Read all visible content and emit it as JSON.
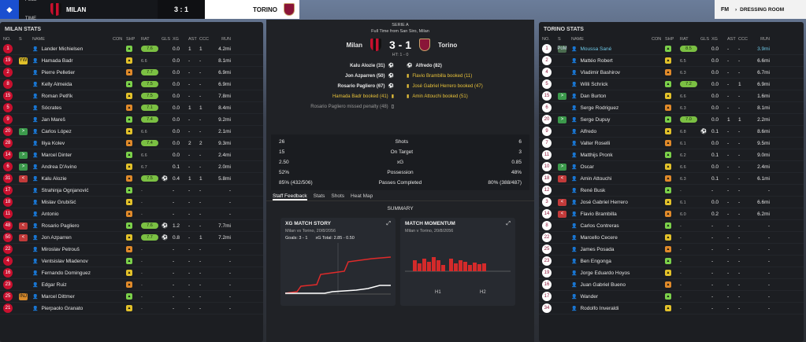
{
  "topbar": {
    "status": "FULL TIME",
    "home_team": "MILAN",
    "score": "3 : 1",
    "away_team": "TORINO",
    "fm_logo": "FM",
    "dressing_room": "DRESSING ROOM"
  },
  "milan": {
    "title": "MILAN STATS",
    "headers": {
      "no": "NO.",
      "s": "S",
      "name": "NAME",
      "con": "CON",
      "shp": "SHP",
      "rat": "RAT",
      "gls": "GLS",
      "xg": "XG",
      "ast": "AST",
      "ccc": "CCC",
      "run": "RUN"
    },
    "players": [
      {
        "no": "1",
        "s": "",
        "name": "Lander Michielsen",
        "rat": "7.6",
        "pill": true,
        "gls": "",
        "xg": "0.0",
        "ast": "1",
        "ccc": "1",
        "run": "4.2mi"
      },
      {
        "no": "19",
        "s": "sub",
        "name": "Hamada Badr",
        "rat": "6.6",
        "pill": false,
        "gls": "",
        "xg": "0.0",
        "ast": "-",
        "ccc": "-",
        "run": "8.1mi"
      },
      {
        "no": "2",
        "s": "",
        "name": "Pierre Pelletier",
        "rat": "7.7",
        "pill": true,
        "gls": "",
        "xg": "0.0",
        "ast": "-",
        "ccc": "-",
        "run": "6.9mi"
      },
      {
        "no": "8",
        "s": "",
        "name": "Kelly Almeida",
        "rat": "7.5",
        "pill": true,
        "gls": "",
        "xg": "0.0",
        "ast": "-",
        "ccc": "-",
        "run": "6.9mi"
      },
      {
        "no": "15",
        "s": "",
        "name": "Roman Petřík",
        "rat": "7.5",
        "pill": true,
        "gls": "",
        "xg": "0.0",
        "ast": "-",
        "ccc": "-",
        "run": "7.8mi"
      },
      {
        "no": "5",
        "s": "",
        "name": "Sócrates",
        "rat": "7.1",
        "pill": true,
        "gls": "",
        "xg": "0.0",
        "ast": "1",
        "ccc": "1",
        "run": "8.4mi"
      },
      {
        "no": "9",
        "s": "",
        "name": "Jan Mareš",
        "rat": "7.4",
        "pill": true,
        "gls": "",
        "xg": "0.0",
        "ast": "-",
        "ccc": "-",
        "run": "9.2mi"
      },
      {
        "no": "20",
        "s": "in",
        "name": "Carlos López",
        "rat": "6.6",
        "pill": false,
        "gls": "",
        "xg": "0.0",
        "ast": "-",
        "ccc": "-",
        "run": "2.1mi"
      },
      {
        "no": "28",
        "s": "",
        "name": "Iliya Kolev",
        "rat": "7.4",
        "pill": true,
        "gls": "",
        "xg": "0.0",
        "ast": "2",
        "ccc": "2",
        "run": "9.3mi"
      },
      {
        "no": "14",
        "s": "in",
        "name": "Marcel Dinter",
        "rat": "6.6",
        "pill": false,
        "gls": "",
        "xg": "0.0",
        "ast": "-",
        "ccc": "-",
        "run": "2.4mi"
      },
      {
        "no": "6",
        "s": "in",
        "name": "Andrea D'Avino",
        "rat": "6.7",
        "pill": false,
        "gls": "",
        "xg": "0.1",
        "ast": "-",
        "ccc": "-",
        "run": "2.0mi"
      },
      {
        "no": "31",
        "s": "out",
        "name": "Kalu Alozie",
        "rat": "7.5",
        "pill": true,
        "gls": "1",
        "xg": "0.4",
        "ast": "1",
        "ccc": "1",
        "run": "5.8mi"
      },
      {
        "no": "17",
        "s": "",
        "name": "Strahinja Ognjanović",
        "rat": "-",
        "pill": false,
        "gls": "",
        "xg": "-",
        "ast": "-",
        "ccc": "-",
        "run": "-"
      },
      {
        "no": "18",
        "s": "",
        "name": "Mislav Grubišić",
        "rat": "-",
        "pill": false,
        "gls": "",
        "xg": "-",
        "ast": "-",
        "ccc": "-",
        "run": "-"
      },
      {
        "no": "11",
        "s": "",
        "name": "Antonio",
        "rat": "-",
        "pill": false,
        "gls": "",
        "xg": "-",
        "ast": "-",
        "ccc": "-",
        "run": "-"
      },
      {
        "no": "48",
        "s": "out",
        "name": "Rosario Pagliero",
        "rat": "7.6",
        "pill": true,
        "gls": "1",
        "xg": "1.2",
        "ast": "-",
        "ccc": "-",
        "run": "7.7mi"
      },
      {
        "no": "50",
        "s": "out",
        "name": "Jon Azparren",
        "rat": "7.7",
        "pill": true,
        "gls": "1",
        "xg": "0.8",
        "ast": "-",
        "ccc": "1",
        "run": "7.2mi"
      },
      {
        "no": "22",
        "s": "",
        "name": "Miroslav Petrouš",
        "rat": "-",
        "pill": false,
        "gls": "",
        "xg": "-",
        "ast": "-",
        "ccc": "-",
        "run": "-"
      },
      {
        "no": "4",
        "s": "",
        "name": "Ventsislav Mladenov",
        "rat": "-",
        "pill": false,
        "gls": "",
        "xg": "-",
        "ast": "-",
        "ccc": "-",
        "run": "-"
      },
      {
        "no": "16",
        "s": "",
        "name": "Fernando Dominguez",
        "rat": "-",
        "pill": false,
        "gls": "",
        "xg": "-",
        "ast": "-",
        "ccc": "-",
        "run": "-"
      },
      {
        "no": "23",
        "s": "",
        "name": "Edgar Ruiz",
        "rat": "-",
        "pill": false,
        "gls": "",
        "xg": "-",
        "ast": "-",
        "ccc": "-",
        "run": "-"
      },
      {
        "no": "25",
        "s": "inj",
        "name": "Marcel Dittmer",
        "rat": "-",
        "pill": false,
        "gls": "",
        "xg": "-",
        "ast": "-",
        "ccc": "-",
        "run": "-"
      },
      {
        "no": "21",
        "s": "",
        "name": "Pierpaolo Granato",
        "rat": "-",
        "pill": false,
        "gls": "",
        "xg": "-",
        "ast": "-",
        "ccc": "-",
        "run": "-"
      }
    ]
  },
  "torino": {
    "title": "TORINO STATS",
    "players": [
      {
        "no": "1",
        "s": "sub",
        "name": "Moussa Sané",
        "rat": "8.5",
        "pill": true,
        "gls": "",
        "xg": "0.0",
        "ast": "-",
        "ccc": "-",
        "run": "3.9mi"
      },
      {
        "no": "2",
        "s": "",
        "name": "Mattéo Robert",
        "rat": "6.5",
        "pill": false,
        "gls": "",
        "xg": "0.0",
        "ast": "-",
        "ccc": "-",
        "run": "6.6mi"
      },
      {
        "no": "4",
        "s": "",
        "name": "Vladimir Bashirov",
        "rat": "6.3",
        "pill": false,
        "gls": "",
        "xg": "0.0",
        "ast": "-",
        "ccc": "-",
        "run": "6.7mi"
      },
      {
        "no": "5",
        "s": "",
        "name": "Willi Schrick",
        "rat": "7.2",
        "pill": true,
        "gls": "",
        "xg": "0.0",
        "ast": "-",
        "ccc": "1",
        "run": "6.9mi"
      },
      {
        "no": "15",
        "s": "in",
        "name": "Dan Burton",
        "rat": "6.6",
        "pill": false,
        "gls": "",
        "xg": "0.0",
        "ast": "-",
        "ccc": "-",
        "run": "1.6mi"
      },
      {
        "no": "6",
        "s": "",
        "name": "Serge Rodriguez",
        "rat": "6.3",
        "pill": false,
        "gls": "",
        "xg": "0.0",
        "ast": "-",
        "ccc": "-",
        "run": "8.1mi"
      },
      {
        "no": "20",
        "s": "in",
        "name": "Serge Dupuy",
        "rat": "7.0",
        "pill": true,
        "gls": "",
        "xg": "0.0",
        "ast": "1",
        "ccc": "1",
        "run": "2.2mi"
      },
      {
        "no": "9",
        "s": "",
        "name": "Alfredo",
        "rat": "6.8",
        "pill": false,
        "gls": "1",
        "xg": "0.1",
        "ast": "-",
        "ccc": "-",
        "run": "8.6mi"
      },
      {
        "no": "7",
        "s": "",
        "name": "Valter Roselli",
        "rat": "6.1",
        "pill": false,
        "gls": "",
        "xg": "0.0",
        "ast": "-",
        "ccc": "-",
        "run": "9.5mi"
      },
      {
        "no": "11",
        "s": "",
        "name": "Matthijs Pronk",
        "rat": "6.2",
        "pill": false,
        "gls": "",
        "xg": "0.1",
        "ast": "-",
        "ccc": "-",
        "run": "9.0mi"
      },
      {
        "no": "10",
        "s": "in",
        "name": "Óscar",
        "rat": "6.6",
        "pill": false,
        "gls": "",
        "xg": "0.0",
        "ast": "-",
        "ccc": "-",
        "run": "2.4mi"
      },
      {
        "no": "18",
        "s": "out",
        "name": "Amin Attouchi",
        "rat": "6.3",
        "pill": false,
        "gls": "",
        "xg": "0.1",
        "ast": "-",
        "ccc": "-",
        "run": "6.1mi"
      },
      {
        "no": "12",
        "s": "",
        "name": "René Busk",
        "rat": "-",
        "pill": false,
        "gls": "",
        "xg": "-",
        "ast": "-",
        "ccc": "-",
        "run": "-"
      },
      {
        "no": "3",
        "s": "out",
        "name": "José Gabriel Herrero",
        "rat": "6.1",
        "pill": false,
        "gls": "",
        "xg": "0.0",
        "ast": "-",
        "ccc": "-",
        "run": "6.6mi"
      },
      {
        "no": "14",
        "s": "out",
        "name": "Flavio Brambilla",
        "rat": "6.0",
        "pill": false,
        "gls": "",
        "xg": "0.2",
        "ast": "-",
        "ccc": "-",
        "run": "6.2mi"
      },
      {
        "no": "8",
        "s": "",
        "name": "Carlos Contreras",
        "rat": "-",
        "pill": false,
        "gls": "",
        "xg": "-",
        "ast": "-",
        "ccc": "-",
        "run": "-"
      },
      {
        "no": "22",
        "s": "",
        "name": "Marcello Cecere",
        "rat": "-",
        "pill": false,
        "gls": "",
        "xg": "-",
        "ast": "-",
        "ccc": "-",
        "run": "-"
      },
      {
        "no": "25",
        "s": "",
        "name": "James Posada",
        "rat": "-",
        "pill": false,
        "gls": "",
        "xg": "-",
        "ast": "-",
        "ccc": "-",
        "run": "-"
      },
      {
        "no": "23",
        "s": "",
        "name": "Ben Engonga",
        "rat": "-",
        "pill": false,
        "gls": "",
        "xg": "-",
        "ast": "-",
        "ccc": "-",
        "run": "-"
      },
      {
        "no": "19",
        "s": "",
        "name": "Jorge Eduardo Hoyos",
        "rat": "-",
        "pill": false,
        "gls": "",
        "xg": "-",
        "ast": "-",
        "ccc": "-",
        "run": "-"
      },
      {
        "no": "16",
        "s": "",
        "name": "Juan Gabriel Bueno",
        "rat": "-",
        "pill": false,
        "gls": "",
        "xg": "-",
        "ast": "-",
        "ccc": "-",
        "run": "-"
      },
      {
        "no": "17",
        "s": "",
        "name": "Wander",
        "rat": "-",
        "pill": false,
        "gls": "",
        "xg": "-",
        "ast": "-",
        "ccc": "-",
        "run": "-"
      },
      {
        "no": "34",
        "s": "",
        "name": "Rodolfo Inveraldi",
        "rat": "-",
        "pill": false,
        "gls": "",
        "xg": "-",
        "ast": "-",
        "ccc": "-",
        "run": "-"
      }
    ]
  },
  "match": {
    "competition": "SERIE A",
    "subtitle": "Full Time from San Siro, Milan",
    "home": "Milan",
    "score": "3 - 1",
    "away": "Torino",
    "ht": "HT: 1 - 0",
    "home_events": [
      {
        "text": "Kalu Alozie (31)",
        "type": "goal"
      },
      {
        "text": "Jon Azparren (50)",
        "type": "goal"
      },
      {
        "text": "Rosario Pagliero (67)",
        "type": "goal"
      },
      {
        "text": "Hamada Badr booked (41)",
        "type": "card"
      },
      {
        "text": "Rosario Pagliero missed penalty (48)",
        "type": "miss"
      }
    ],
    "away_events": [
      {
        "text": "Alfredo (82)",
        "type": "goal"
      },
      {
        "text": "Flavio Brambilla booked (11)",
        "type": "card"
      },
      {
        "text": "José Gabriel Herrero booked (47)",
        "type": "card"
      },
      {
        "text": "Amin Attouchi booked (51)",
        "type": "card"
      }
    ],
    "stats": [
      {
        "l": "26",
        "label": "Shots",
        "r": "6"
      },
      {
        "l": "15",
        "label": "On Target",
        "r": "3"
      },
      {
        "l": "2.50",
        "label": "xG",
        "r": "0.85"
      },
      {
        "l": "52%",
        "label": "Possession",
        "r": "48%"
      },
      {
        "l": "85% (432/506)",
        "label": "Passes Completed",
        "r": "80% (388/487)"
      }
    ],
    "tabs": [
      "Staff Feedback",
      "Stats",
      "Shots",
      "Heat Map"
    ],
    "summary": "SUMMARY",
    "xg_card": {
      "title": "XG MATCH STORY",
      "sub": "Milan vs Torino, 20/8/2056",
      "goals": "Goals: 3 - 1",
      "xg_total": "xG Total: 2.85 - 0.50"
    },
    "mom_card": {
      "title": "MATCH MOMENTUM",
      "sub": "Milan v Torino, 20/8/2056",
      "h1": "H1",
      "h2": "H2"
    }
  },
  "colors": {
    "milan_red": "#c8102e",
    "torino_maroon": "#8a1538",
    "rating_green": "#7bc043"
  }
}
